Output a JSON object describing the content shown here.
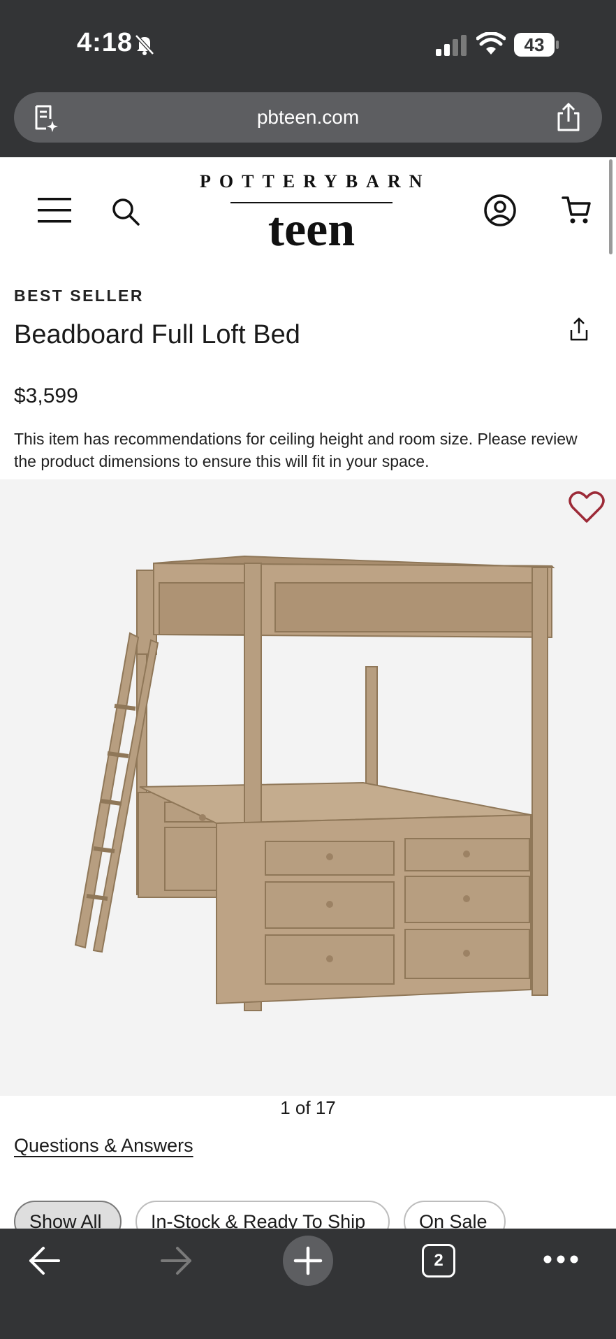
{
  "status_bar": {
    "time": "4:18",
    "battery": "43"
  },
  "browser": {
    "url": "pbteen.com",
    "tab_count": "2"
  },
  "header": {
    "logo_top": "POTTERYBARN",
    "logo_bottom": "teen"
  },
  "product": {
    "badge": "BEST SELLER",
    "title": "Beadboard Full Loft Bed",
    "price": "$3,599",
    "notice": "This item has recommendations for ceiling height and room size. Please review the product dimensions to ensure this will fit in your space.",
    "image_counter": "1 of 17"
  },
  "links": {
    "qa": "Questions & Answers"
  },
  "filters": [
    {
      "label": "Show All",
      "active": true
    },
    {
      "label": "In-Stock & Ready To Ship",
      "active": false
    },
    {
      "label": "On Sale",
      "active": false
    }
  ],
  "colors": {
    "chrome": "#333436",
    "url_bar": "#5d5e61",
    "image_bg": "#f3f3f3",
    "heart": "#9c2a37",
    "wood": "#b79e80"
  },
  "icons": [
    "bell-slash-icon",
    "signal-icon",
    "wifi-icon",
    "reader-icon",
    "share-icon",
    "menu-icon",
    "search-icon",
    "account-icon",
    "cart-icon",
    "heart-icon",
    "back-icon",
    "forward-icon",
    "plus-icon",
    "tabs-icon",
    "more-icon"
  ]
}
